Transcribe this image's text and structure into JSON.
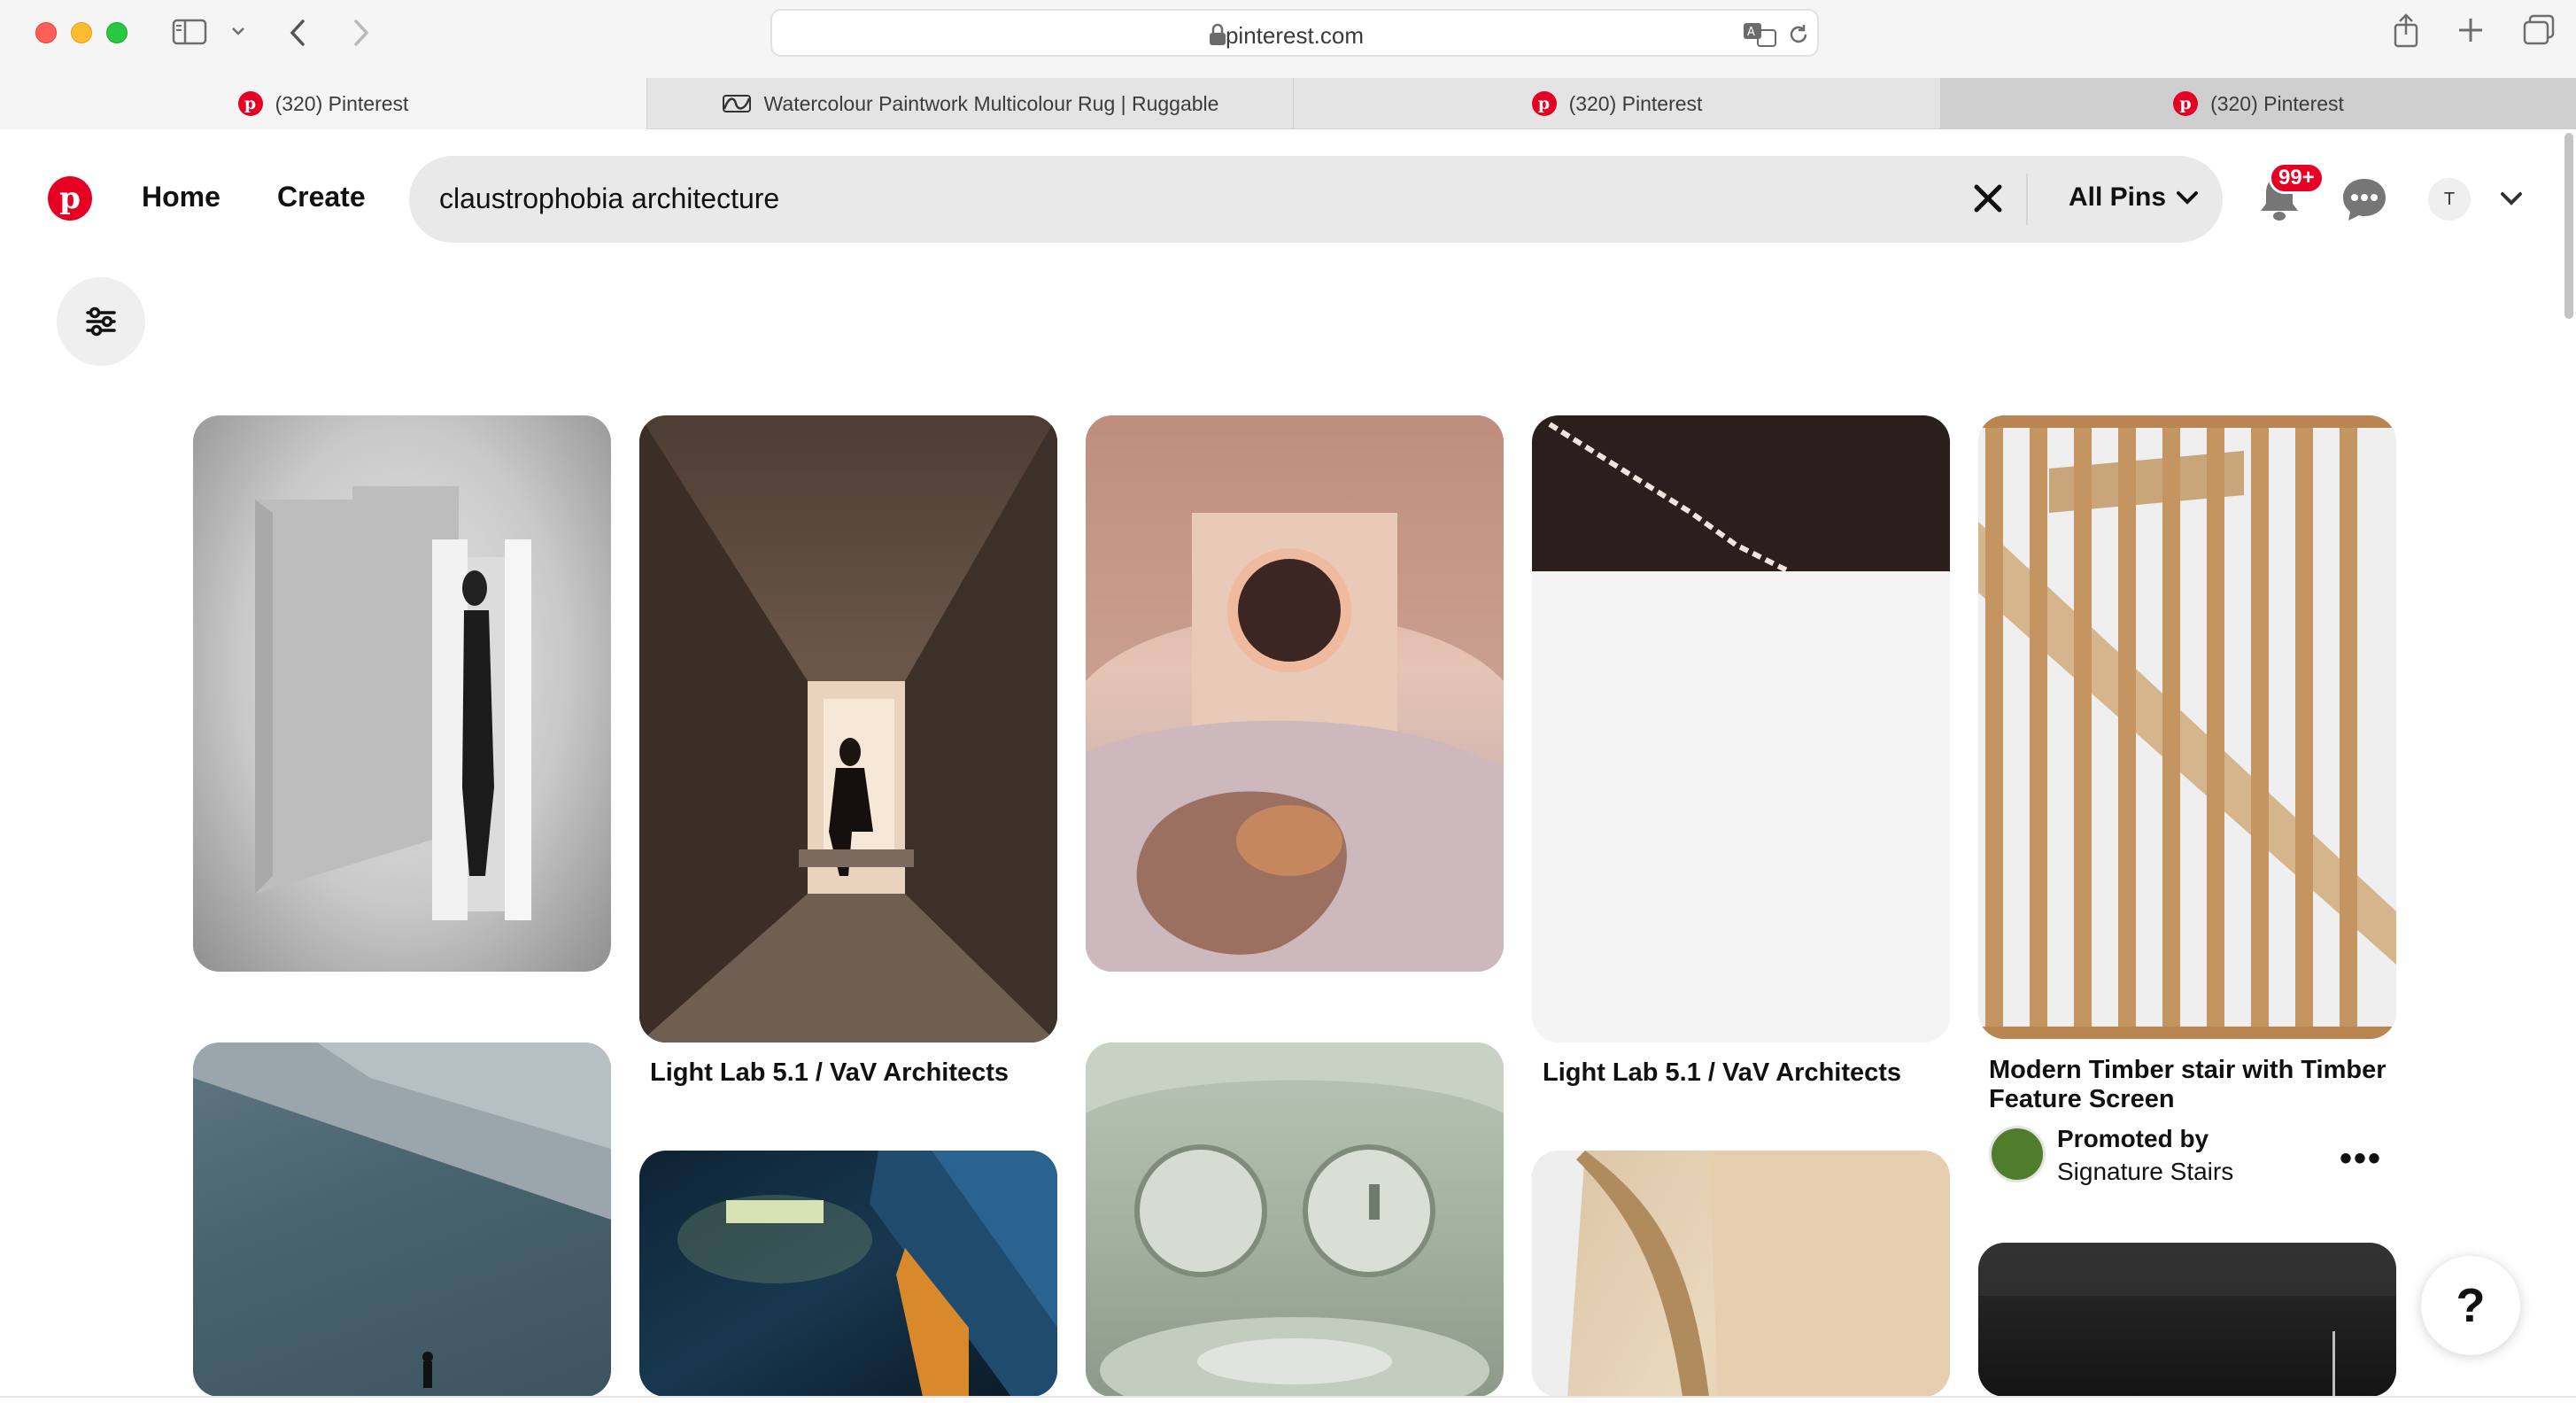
{
  "browser": {
    "url": "pinterest.com",
    "tabs": [
      {
        "title": "(320) Pinterest",
        "icon": "pinterest-icon"
      },
      {
        "title": "Watercolour Paintwork Multicolour Rug | Ruggable",
        "icon": "ruggable-icon"
      },
      {
        "title": "(320) Pinterest",
        "icon": "pinterest-icon"
      },
      {
        "title": "(320) Pinterest",
        "icon": "pinterest-icon"
      }
    ]
  },
  "header": {
    "logo_letter": "p",
    "nav": {
      "home": "Home",
      "create": "Create"
    },
    "search": {
      "query": "claustrophobia architecture",
      "filter": "All Pins"
    },
    "notifications_badge": "99+",
    "avatar_initial": "T"
  },
  "pins": {
    "p2_title": "Light Lab 5.1 / VaV Architects",
    "p4_title": "Light Lab 5.1 / VaV Architects",
    "p5_title_line1": "Modern Timber stair with Timber",
    "p5_title_line2": "Feature Screen",
    "p5_promoted_by": "Promoted by",
    "p5_advertiser": "Signature Stairs",
    "p5_more": "•••"
  },
  "help": {
    "label": "?"
  },
  "colors": {
    "brand": "#e60023",
    "search_bg": "#e9e9e9",
    "text": "#111111"
  }
}
